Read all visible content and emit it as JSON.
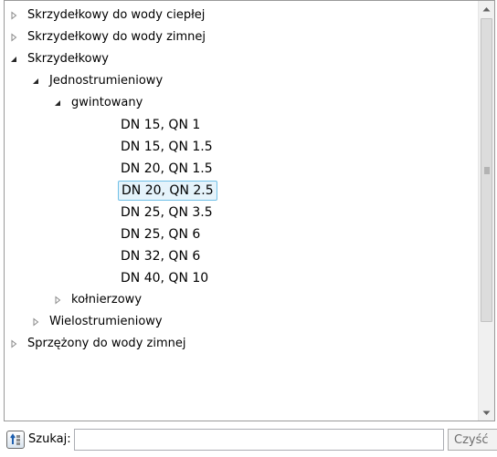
{
  "tree": {
    "nodes": [
      {
        "label": "Skrzydełkowy do wody ciepłej",
        "level": 0,
        "state": "collapsed"
      },
      {
        "label": "Skrzydełkowy do wody zimnej",
        "level": 0,
        "state": "collapsed"
      },
      {
        "label": "Skrzydełkowy",
        "level": 0,
        "state": "expanded"
      },
      {
        "label": "Jednostrumieniowy",
        "level": 1,
        "state": "expanded"
      },
      {
        "label": "gwintowany",
        "level": 2,
        "state": "expanded"
      },
      {
        "label": "DN 15, QN 1",
        "level": 3,
        "state": "leaf"
      },
      {
        "label": "DN 15, QN 1.5",
        "level": 3,
        "state": "leaf"
      },
      {
        "label": "DN 20, QN 1.5",
        "level": 3,
        "state": "leaf"
      },
      {
        "label": "DN 20, QN 2.5",
        "level": 3,
        "state": "leaf",
        "selected": true
      },
      {
        "label": "DN 25, QN 3.5",
        "level": 3,
        "state": "leaf"
      },
      {
        "label": "DN 25, QN 6",
        "level": 3,
        "state": "leaf"
      },
      {
        "label": "DN 32, QN 6",
        "level": 3,
        "state": "leaf"
      },
      {
        "label": "DN 40, QN 10",
        "level": 3,
        "state": "leaf"
      },
      {
        "label": "kołnierzowy",
        "level": 2,
        "state": "collapsed"
      },
      {
        "label": "Wielostrumieniowy",
        "level": 1,
        "state": "collapsed"
      },
      {
        "label": "Sprzężony do wody zimnej",
        "level": 0,
        "state": "collapsed"
      }
    ]
  },
  "search": {
    "label": "Szukaj:",
    "value": "",
    "placeholder": "",
    "clear_label": "Czyść"
  },
  "icons": {
    "collapsed": "triangle-right-outline-icon",
    "expanded": "triangle-down-filled-icon",
    "search_toggle": "tree-search-icon",
    "scroll_up": "scroll-up-arrow-icon",
    "scroll_down": "scroll-down-arrow-icon"
  },
  "colors": {
    "selection_fill": "#e5f3fb",
    "selection_border": "#70c0e7"
  }
}
